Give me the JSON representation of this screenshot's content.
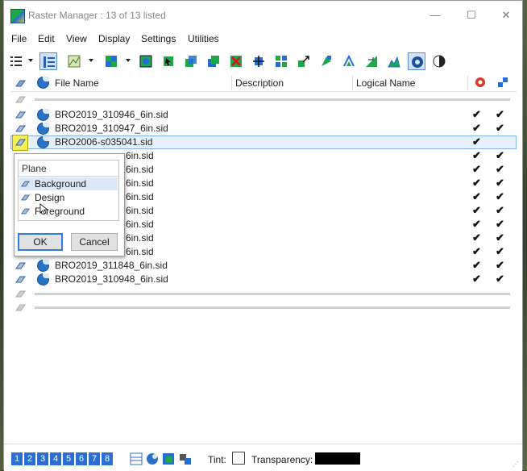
{
  "window": {
    "title": "Raster Manager : 13 of 13 listed",
    "minimize_glyph": "—",
    "maximize_glyph": "☐",
    "close_glyph": "✕"
  },
  "menu": [
    "File",
    "Edit",
    "View",
    "Display",
    "Settings",
    "Utilities"
  ],
  "columns": {
    "file_name": "File Name",
    "description": "Description",
    "logical_name": "Logical Name"
  },
  "rows": [
    {
      "file": "BRO2019_310946_6in.sid",
      "c1": "✔",
      "c2": "✔"
    },
    {
      "file": "BRO2019_310947_6in.sid",
      "c1": "✔",
      "c2": "✔"
    },
    {
      "file": "BRO2006-s035041.sid",
      "c1": "✔",
      "c2": ""
    },
    {
      "file": "6in.sid",
      "c1": "✔",
      "c2": "✔"
    },
    {
      "file": "6in.sid",
      "c1": "✔",
      "c2": "✔"
    },
    {
      "file": "6in.sid",
      "c1": "✔",
      "c2": "✔"
    },
    {
      "file": "6in.sid",
      "c1": "✔",
      "c2": "✔"
    },
    {
      "file": "6in.sid",
      "c1": "✔",
      "c2": "✔"
    },
    {
      "file": "6in.sid",
      "c1": "✔",
      "c2": "✔"
    },
    {
      "file": "6in.sid",
      "c1": "✔",
      "c2": "✔"
    },
    {
      "file": "6in.sid",
      "c1": "✔",
      "c2": "✔"
    },
    {
      "file": "BRO2019_311848_6in.sid",
      "c1": "✔",
      "c2": "✔"
    },
    {
      "file": "BRO2019_310948_6in.sid",
      "c1": "✔",
      "c2": "✔"
    }
  ],
  "plane_dialog": {
    "header": "Plane",
    "options": [
      "Background",
      "Design",
      "Foreground"
    ],
    "selected": "Background",
    "ok": "OK",
    "cancel": "Cancel"
  },
  "status": {
    "views": [
      "1",
      "2",
      "3",
      "4",
      "5",
      "6",
      "7",
      "8"
    ],
    "tint_label": "Tint:",
    "transparency_label": "Transparency:"
  },
  "colors": {
    "accent": "#2a6fd1",
    "selection": "#e5f0fb",
    "highlight": "#f3f05a"
  }
}
